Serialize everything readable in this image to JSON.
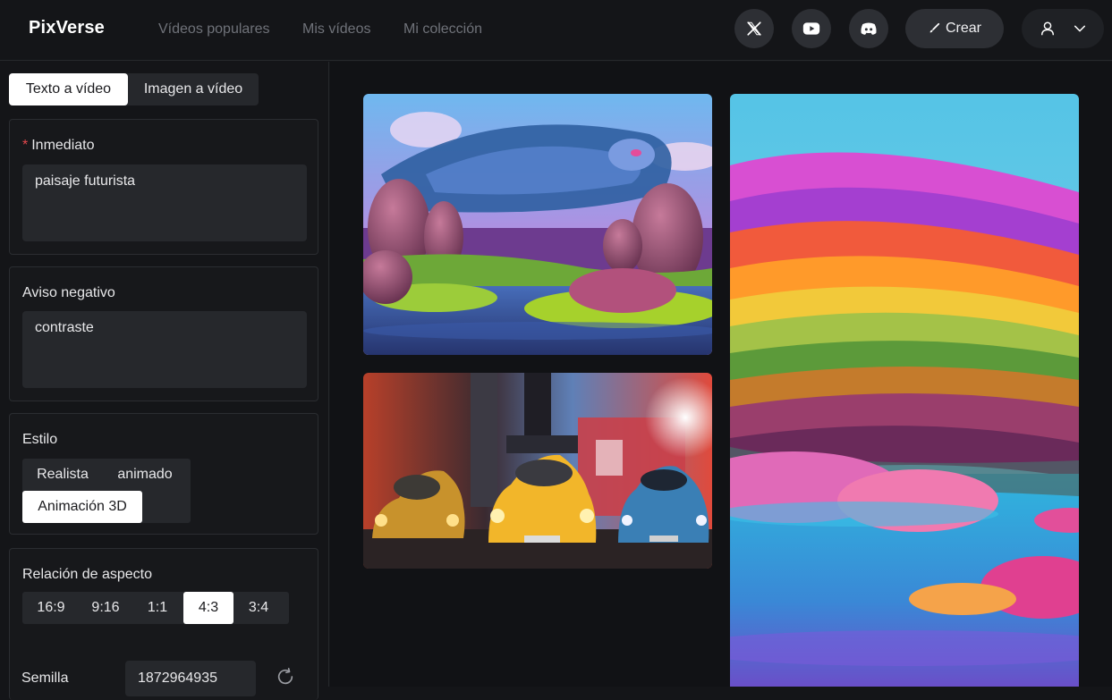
{
  "header": {
    "logo": "PixVerse",
    "nav": [
      "Vídeos populares",
      "Mis vídeos",
      "Mi colección"
    ],
    "create_label": "Crear",
    "social_icons": [
      "x-icon",
      "youtube-icon",
      "discord-icon"
    ]
  },
  "sidebar": {
    "mode_tabs": [
      "Texto a vídeo",
      "Imagen a vídeo"
    ],
    "active_mode": "Texto a vídeo",
    "prompt": {
      "required_mark": "*",
      "label": "Inmediato",
      "value": "paisaje futurista"
    },
    "negative": {
      "label": "Aviso negativo",
      "value": "contraste"
    },
    "style": {
      "label": "Estilo",
      "options": [
        "Realista",
        "animado",
        "Animación 3D"
      ],
      "selected": "Animación 3D"
    },
    "aspect": {
      "label": "Relación de aspecto",
      "options": [
        "16:9",
        "9:16",
        "1:1",
        "4:3",
        "3:4"
      ],
      "selected": "4:3"
    },
    "seed": {
      "label": "Semilla",
      "value": "1872964935"
    }
  },
  "colors": {
    "background": "#141518",
    "panel": "#17181b",
    "control": "#26282c",
    "active": "#ffffff",
    "muted": "#6f7279"
  }
}
